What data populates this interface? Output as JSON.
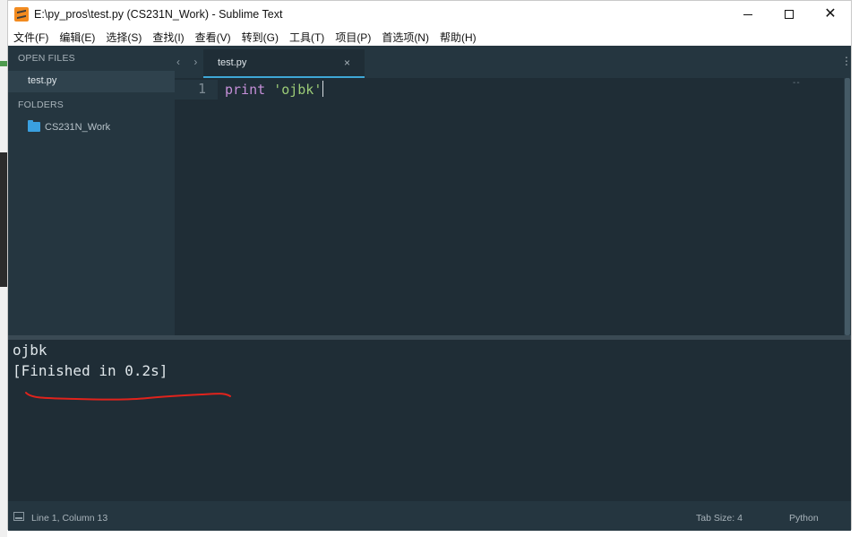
{
  "window": {
    "title": "E:\\py_pros\\test.py (CS231N_Work) - Sublime Text",
    "close_glyph": "✕"
  },
  "menu": [
    "文件(F)",
    "编辑(E)",
    "选择(S)",
    "查找(I)",
    "查看(V)",
    "转到(G)",
    "工具(T)",
    "项目(P)",
    "首选项(N)",
    "帮助(H)"
  ],
  "sidebar": {
    "open_files_header": "OPEN FILES",
    "open_files": [
      "test.py"
    ],
    "folders_header": "FOLDERS",
    "folders": [
      "CS231N_Work"
    ]
  },
  "tabs": {
    "nav_glyph": "‹ ›",
    "active_label": "test.py",
    "close_glyph": "×",
    "menu_glyph": "⋮"
  },
  "editor": {
    "line_number": "1",
    "code_keyword": "print",
    "code_space": " ",
    "code_string": "'ojbk'",
    "minimap_glyph": "--"
  },
  "output": {
    "line1": "ojbk",
    "line2": "[Finished in 0.2s]"
  },
  "status": {
    "position": "Line 1, Column 13",
    "tab_size": "Tab Size: 4",
    "syntax": "Python"
  },
  "colors": {
    "editor_bg": "#1f2d36",
    "sidebar_bg": "#253640",
    "accent": "#3ea7d6",
    "keyword": "#c58fd8",
    "string": "#9ccc77",
    "annotation": "#e0231c"
  }
}
